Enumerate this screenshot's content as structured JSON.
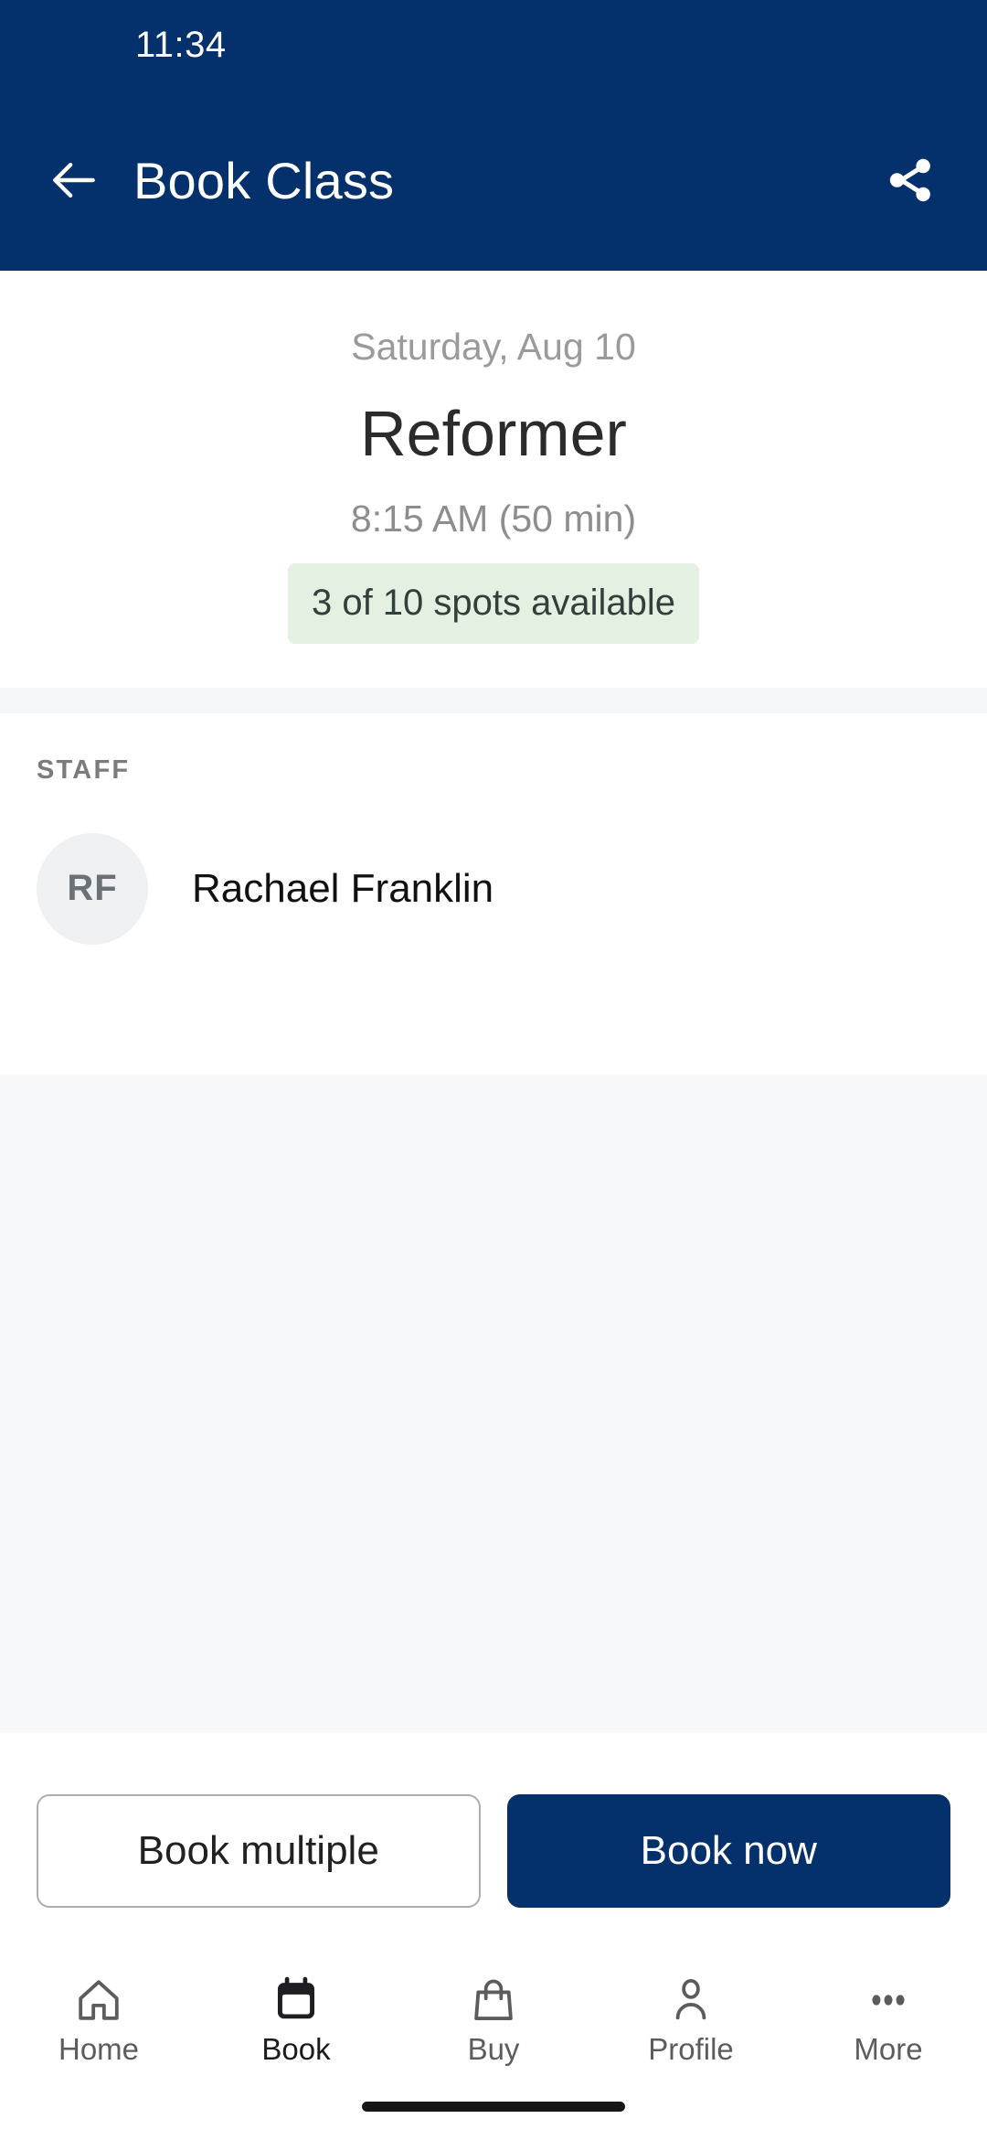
{
  "status_bar": {
    "time": "11:34"
  },
  "app_bar": {
    "title": "Book Class",
    "back_icon": "arrow-left-icon",
    "share_icon": "share-icon"
  },
  "class_details": {
    "date": "Saturday, Aug 10",
    "name": "Reformer",
    "time_duration": "8:15 AM (50 min)",
    "availability": "3 of 10 spots available",
    "spots_available": 3,
    "spots_total": 10
  },
  "staff_section": {
    "heading": "STAFF",
    "members": [
      {
        "initials": "RF",
        "name": "Rachael Franklin"
      }
    ]
  },
  "actions": {
    "secondary_label": "Book multiple",
    "primary_label": "Book now"
  },
  "bottom_nav": {
    "items": [
      {
        "label": "Home",
        "icon": "home-icon",
        "active": false
      },
      {
        "label": "Book",
        "icon": "calendar-icon",
        "active": true
      },
      {
        "label": "Buy",
        "icon": "shopping-bag-icon",
        "active": false
      },
      {
        "label": "Profile",
        "icon": "person-icon",
        "active": false
      },
      {
        "label": "More",
        "icon": "ellipsis-icon",
        "active": false
      }
    ]
  },
  "colors": {
    "brand_navy": "#04306b",
    "badge_green_bg": "#e4f0e2",
    "badge_green_text": "#31403a",
    "page_gray": "#f7f8fa",
    "avatar_bg": "#eef0f2"
  }
}
